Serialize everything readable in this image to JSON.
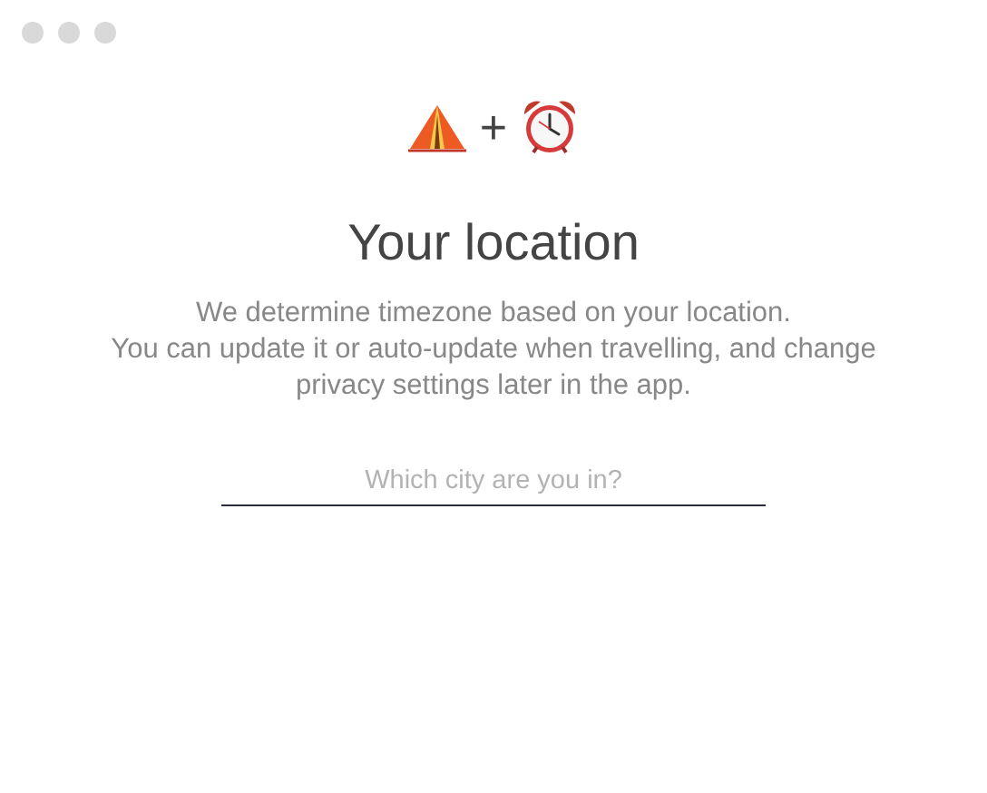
{
  "header": {
    "joiner": "+"
  },
  "title": "Your location",
  "description": "We determine timezone based on your location.\nYou can update it or auto-update when travelling, and change privacy settings later in the app.",
  "city_field": {
    "placeholder": "Which city are you in?"
  }
}
